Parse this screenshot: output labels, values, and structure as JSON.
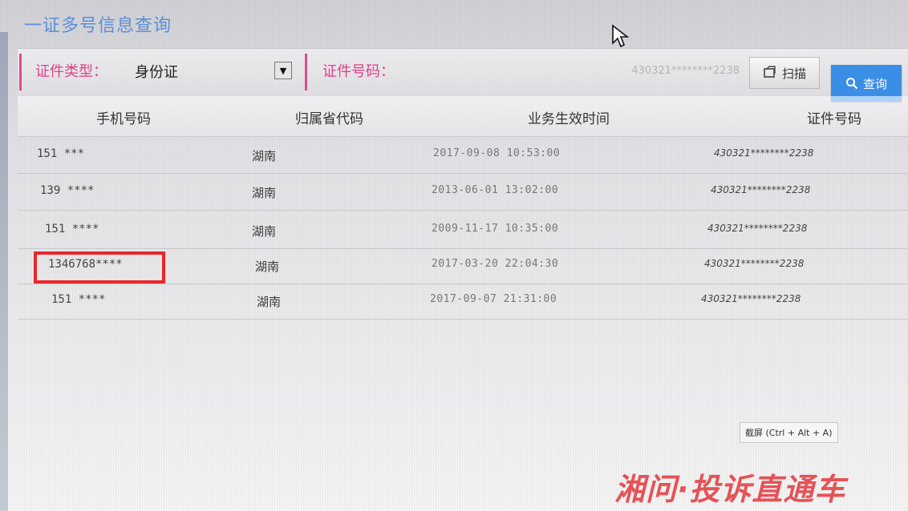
{
  "window": {
    "title": "一证多号信息查询"
  },
  "filters": {
    "id_type_label": "证件类型：",
    "id_type_value": "身份证",
    "id_number_label": "证件号码：",
    "id_number_value": "430321********2238",
    "scan_label": "扫描",
    "query_label": "查询"
  },
  "table": {
    "columns": [
      "手机号码",
      "归属省代码",
      "业务生效时间",
      "证件号码"
    ],
    "rows": [
      {
        "phone": "151 ***",
        "province": "湖南",
        "time": "2017-09-08 10:53:00",
        "id_number": "430321********2238"
      },
      {
        "phone": "139 ****",
        "province": "湖南",
        "time": "2013-06-01 13:02:00",
        "id_number": "430321********2238"
      },
      {
        "phone": "151 ****",
        "province": "湖南",
        "time": "2009-11-17 10:35:00",
        "id_number": "430321********2238"
      },
      {
        "phone": "1346768****",
        "province": "湖南",
        "time": "2017-03-20 22:04:30",
        "id_number": "430321********2238"
      },
      {
        "phone": "151 ****",
        "province": "湖南",
        "time": "2017-09-07 21:31:00",
        "id_number": "430321********2238"
      }
    ]
  },
  "tooltip": {
    "text": "截屏 (Ctrl + Alt + A)"
  },
  "watermark": {
    "text": "湘问·投诉直通车"
  },
  "colors": {
    "accent": "#3a8ee6",
    "label_pink": "#e0408a",
    "highlight": "#e8262b",
    "title_blue": "#5b8fd6"
  }
}
